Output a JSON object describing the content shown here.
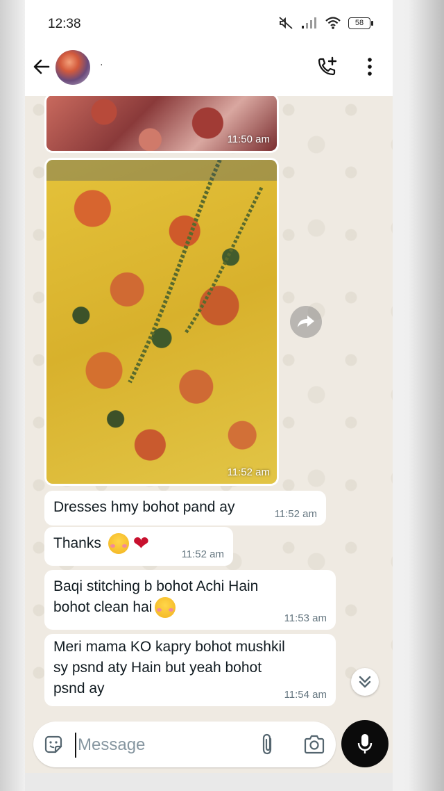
{
  "status_bar": {
    "time": "12:38",
    "battery": "58",
    "icons": [
      "mute-icon",
      "signal-icon",
      "wifi-icon",
      "battery-icon"
    ]
  },
  "header": {
    "contact_name": "·",
    "icons": [
      "back-arrow-icon",
      "avatar",
      "add-call-icon",
      "more-vert-icon"
    ]
  },
  "messages": [
    {
      "type": "image",
      "time": "11:50 am",
      "description": "floral fabric"
    },
    {
      "type": "image",
      "time": "11:52 am",
      "description": "yellow floral fabric"
    },
    {
      "type": "text",
      "text": "Dresses hmy bohot pand ay",
      "time": "11:52 am"
    },
    {
      "type": "text",
      "text": "Thanks",
      "emoji": [
        "smiling-face-with-hearts",
        "red-heart"
      ],
      "time": "11:52 am"
    },
    {
      "type": "text",
      "text_line1": "Baqi stitching b bohot Achi Hain",
      "text_line2": "bohot clean hai",
      "emoji": [
        "smiling-face-with-hearts"
      ],
      "time": "11:53 am"
    },
    {
      "type": "text",
      "text_line1": "Meri mama KO kapry bohot mushkil",
      "text_line2": "sy psnd aty Hain but yeah bohot",
      "text_line3": "psnd ay",
      "time": "11:54 am"
    }
  ],
  "input": {
    "placeholder": "Message"
  },
  "colors": {
    "chat_bg": "#efeae2",
    "bubble": "#ffffff",
    "time_text": "#667781",
    "mic_button": "#0b0b0b"
  }
}
